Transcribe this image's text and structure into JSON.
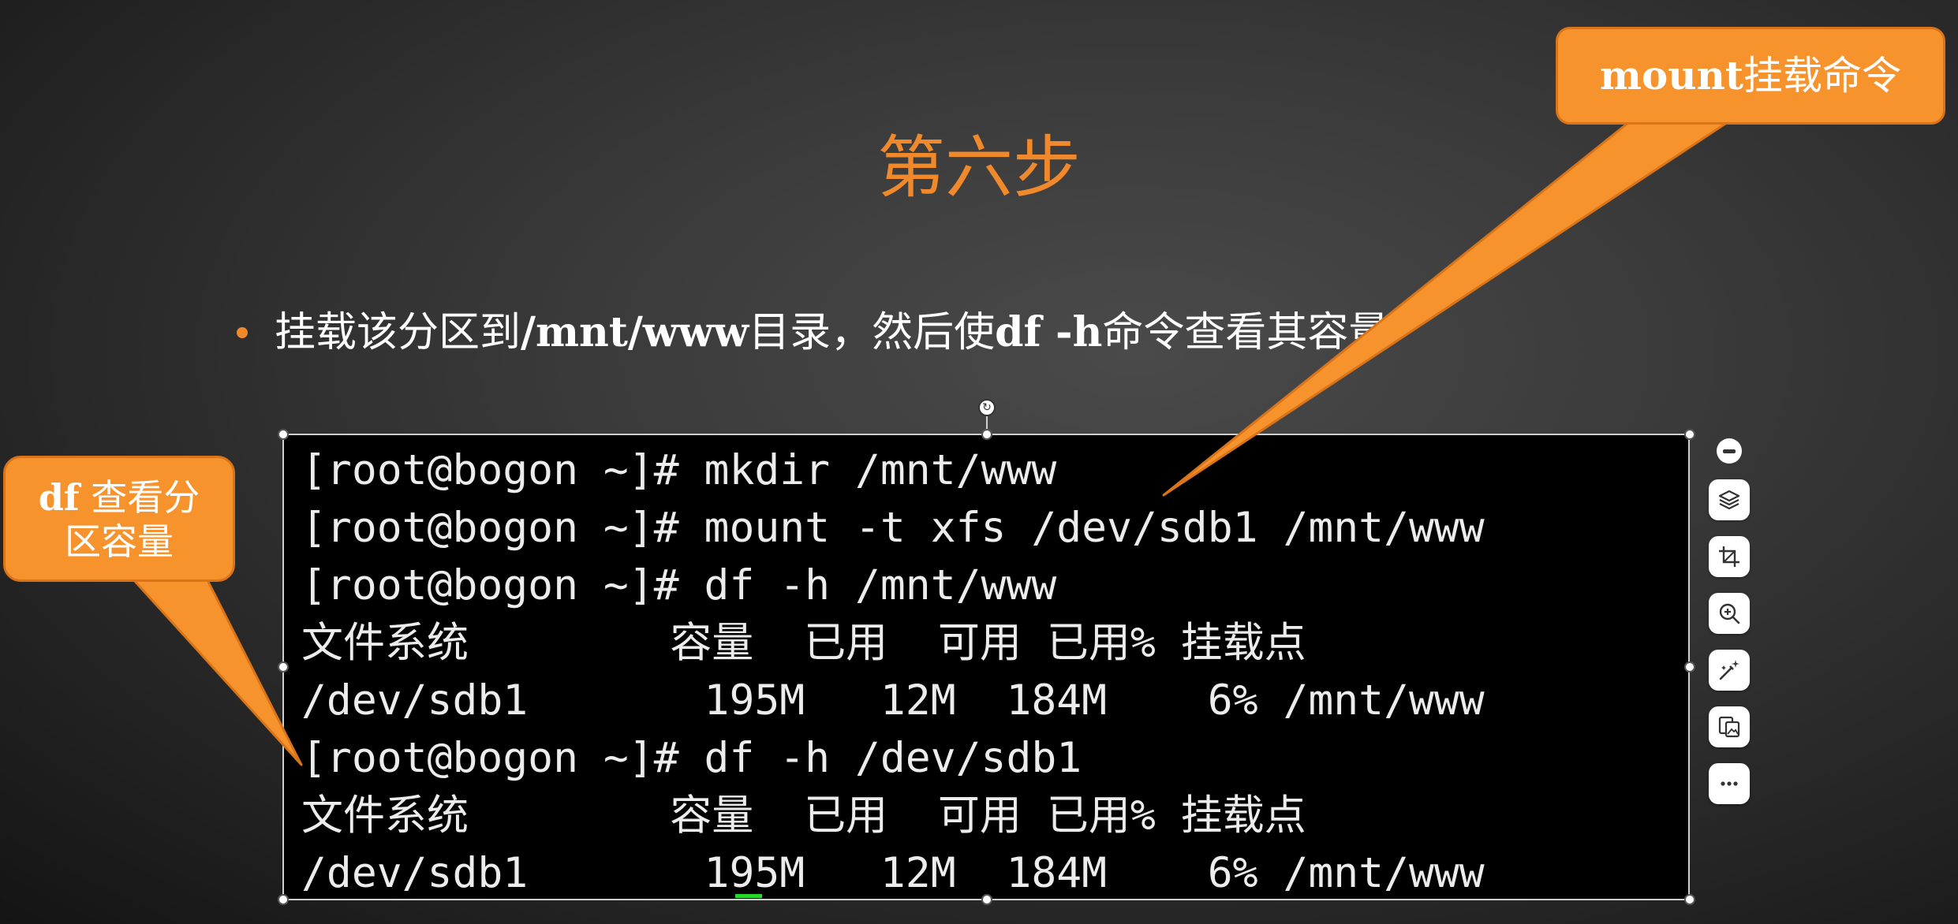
{
  "slide": {
    "title": "第六步",
    "bullet": {
      "prefix": "挂载该分区到",
      "path": "/mnt/www",
      "middle": "目录，然后使",
      "command": "df -h",
      "suffix": "命令查看其容量"
    }
  },
  "terminal": {
    "lines": [
      "[root@bogon ~]# mkdir /mnt/www",
      "[root@bogon ~]# mount -t xfs /dev/sdb1 /mnt/www",
      "[root@bogon ~]# df -h /mnt/www",
      "文件系统        容量  已用  可用 已用% 挂载点",
      "/dev/sdb1       195M   12M  184M    6% /mnt/www",
      "[root@bogon ~]# df -h /dev/sdb1",
      "文件系统        容量  已用  可用 已用% 挂载点",
      "/dev/sdb1       195M   12M  184M    6% /mnt/www"
    ]
  },
  "callouts": {
    "right": {
      "bold": "mount",
      "text": "挂载命令"
    },
    "left": {
      "bold": "df",
      "line1": " 查看分",
      "line2": "区容量"
    }
  },
  "toolbar": {
    "tools": [
      "collapse-icon",
      "layers-icon",
      "crop-icon",
      "zoom-in-icon",
      "magic-wand-icon",
      "image-convert-icon",
      "more-icon"
    ]
  },
  "colors": {
    "accent": "#f0892b",
    "callout_fill": "#f7932d",
    "terminal_bg": "#000000",
    "terminal_text": "#ececec",
    "cursor": "#28d828"
  }
}
